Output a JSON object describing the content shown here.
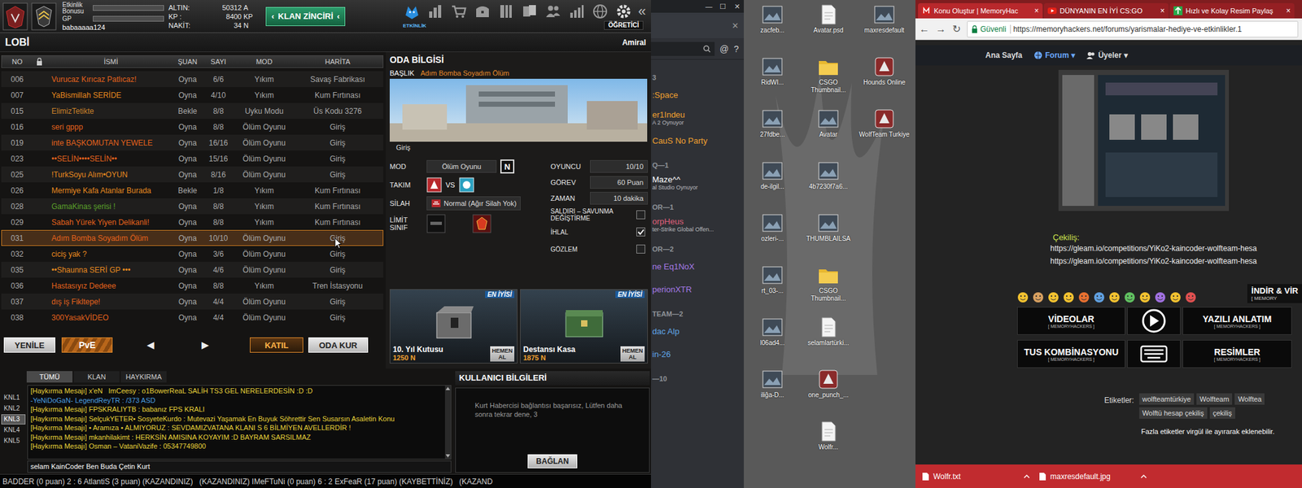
{
  "game": {
    "header": {
      "bonus_label": "Etkinlik Bonusu",
      "bonus_level": 0,
      "gp_label": "GP",
      "gp_level": 0,
      "username": "babaaaaa124",
      "currencies": [
        {
          "label": "ALTIN:",
          "value": "50312",
          "unit": "A"
        },
        {
          "label": "KP :",
          "value": "8400",
          "unit": "KP"
        },
        {
          "label": "NAKİT:",
          "value": "34",
          "unit": "N"
        }
      ],
      "clan_chain": {
        "left": "‹",
        "label": "KLAN ZİNCİRİ",
        "right": "‹"
      },
      "event_label": "ETKİNLİK",
      "collapse": "«",
      "tutorial": "ÖĞRETİCİ"
    },
    "lobby": {
      "title": "LOBİ",
      "rank": "Amiral",
      "columns": [
        "NO",
        "İSMİ",
        "ŞUAN",
        "SAYI",
        "MOD",
        "HARİTA"
      ],
      "rows": [
        {
          "cells": [
            "006",
            "Vurucaz Kırıcaz Patlıcaz!",
            "Oyna",
            "6/6",
            "Yıkım",
            "Savaş Fabrikası"
          ],
          "color": "#e3621c",
          "selected": false
        },
        {
          "cells": [
            "007",
            "YaBismillah SERİDE",
            "Oyna",
            "4/10",
            "Yıkım",
            "Kum Fırtınası"
          ],
          "color": "#e6891f",
          "selected": false
        },
        {
          "cells": [
            "015",
            "ElimizTetikte",
            "Bekle",
            "8/8",
            "Uyku Modu",
            "Üs Kodu 3276"
          ],
          "color": "#c9812a",
          "selected": false
        },
        {
          "cells": [
            "016",
            "seri gppp",
            "Oyna",
            "8/8",
            "Ölüm Oyunu",
            "Giriş"
          ],
          "color": "#e3621c",
          "selected": false
        },
        {
          "cells": [
            "019",
            "inte BAŞKOMUTAN YEWELE",
            "Oyna",
            "16/16",
            "Ölüm Oyunu",
            "Giriş"
          ],
          "color": "#e3621c",
          "selected": false
        },
        {
          "cells": [
            "023",
            "••SELİN••••SELİN••",
            "Oyna",
            "15/16",
            "Ölüm Oyunu",
            "Giriş"
          ],
          "color": "#e3621c",
          "selected": false
        },
        {
          "cells": [
            "025",
            "!TurkSoyu Alım•OYUN",
            "Oyna",
            "8/16",
            "Ölüm Oyunu",
            "Giriş"
          ],
          "color": "#e6891f",
          "selected": false
        },
        {
          "cells": [
            "026",
            "Mermiye Kafa Atanlar Burada",
            "Bekle",
            "1/8",
            "Yıkım",
            "Kum Fırtınası"
          ],
          "color": "#e6891f",
          "selected": false
        },
        {
          "cells": [
            "028",
            "GamaKinas şerisi !",
            "Oyna",
            "8/8",
            "Yıkım",
            "Kum Fırtınası"
          ],
          "color": "#5aa02a",
          "selected": false
        },
        {
          "cells": [
            "029",
            "Sabah Yürek Yiyen Delikanli!",
            "Oyna",
            "8/8",
            "Yıkım",
            "Kum Fırtınası"
          ],
          "color": "#e3621c",
          "selected": false
        },
        {
          "cells": [
            "031",
            "Adım Bomba Soyadım Ölüm",
            "Oyna",
            "10/10",
            "Ölüm Oyunu",
            "Giriş"
          ],
          "color": "#e3621c",
          "selected": true
        },
        {
          "cells": [
            "032",
            "ciciş yak ?",
            "Oyna",
            "3/6",
            "Ölüm Oyunu",
            "Giriş"
          ],
          "color": "#e6891f",
          "selected": false
        },
        {
          "cells": [
            "035",
            "••Shaunna SERİ GP •••",
            "Oyna",
            "4/6",
            "Ölüm Oyunu",
            "Giriş"
          ],
          "color": "#e6891f",
          "selected": false
        },
        {
          "cells": [
            "036",
            "Hastasıyız Dedeee",
            "Oyna",
            "8/8",
            "Yıkım",
            "Tren İstasyonu"
          ],
          "color": "#e3621c",
          "selected": false
        },
        {
          "cells": [
            "037",
            "dış iş Fikltepe!",
            "Oyna",
            "4/4",
            "Ölüm Oyunu",
            "Giriş"
          ],
          "color": "#e3621c",
          "selected": false
        },
        {
          "cells": [
            "038",
            "300YasakVİDEO",
            "Oyna",
            "4/4",
            "Ölüm Oyunu",
            "Giriş"
          ],
          "color": "#e3621c",
          "selected": false
        }
      ],
      "buttons": {
        "refresh": "YENİLE",
        "mode": "PvE",
        "prev": "◀",
        "next": "▶",
        "join": "KATIL",
        "create": "ODA KUR"
      }
    },
    "room": {
      "title": "ODA BİLGİSİ",
      "heading_label": "BAŞLIK",
      "heading": "Adım Bomba Soyadım Ölüm",
      "map_caption": "Giriş",
      "mode_label": "MOD",
      "mode": "Ölüm Oyunu",
      "mode_badge": "N",
      "team_label": "TAKIM",
      "versus": "VS",
      "weapon_label": "SİLAH",
      "weapon": "Normal (Ağır Silah Yok)",
      "limit_label": "LİMİT SINIF",
      "stats": [
        {
          "label": "OYUNCU",
          "value": "10/10"
        },
        {
          "label": "GÖREV",
          "value": "60 Puan"
        },
        {
          "label": "ZAMAN",
          "value": "10 dakika"
        }
      ],
      "options": [
        {
          "label": "SALDIRI – SAVUNMA DEĞİŞTİRME",
          "checked": false
        },
        {
          "label": "İHLAL",
          "checked": true
        },
        {
          "label": "GÖZLEM",
          "checked": false
        }
      ]
    },
    "store": [
      {
        "name": "10. Yıl Kutusu",
        "price": "1250 N",
        "badge": "EN İYİSİ",
        "buy": "HEMEN AL"
      },
      {
        "name": "Destansı Kasa",
        "price": "1875 N",
        "badge": "EN İYİSİ",
        "buy": "HEMEN AL"
      }
    ],
    "chat": {
      "tabs": [
        {
          "label": "TÜMÜ",
          "selected": true
        },
        {
          "label": "KLAN",
          "selected": false
        },
        {
          "label": "HAYKIRMA",
          "selected": false
        }
      ],
      "channels": [
        {
          "label": "KNL1",
          "selected": false
        },
        {
          "label": "KNL2",
          "selected": false
        },
        {
          "label": "KNL3",
          "selected": true
        },
        {
          "label": "KNL4",
          "selected": false
        },
        {
          "label": "KNL5",
          "selected": false
        }
      ],
      "lines": [
        {
          "text": "[Haykırma Mesajı] x'eN   ImCeesy : o1BowerReaL SALİH TS3 GEL NERELERDESİN :D :D",
          "color": "#e8d33a"
        },
        {
          "text": "-YeNiDoGaN- LegendReyTR : /373 ASD",
          "color": "#4a9fe0"
        },
        {
          "text": "[Haykırma Mesajı] FPSKRALIYTB : babanız FPS KRALI",
          "color": "#e8d33a"
        },
        {
          "text": "[Haykırma Mesajı] SelçukYETER• SosyeteKurdo : Mutevazi Yaşamak En Buyuk Söhrettir Sen Susarsın Asaletin Konu",
          "color": "#e8d33a"
        },
        {
          "text": "[Haykırma Mesajı] • Aramıza • ALMIYORUZ : SEVDAMIZVATANA KLANI S 6 BİLMİYEN AVELLERDİR !",
          "color": "#e8d33a"
        },
        {
          "text": "[Haykırma Mesajı] mkanhilakimt : HERKSİN AMISINA KOYAYIM :D BAYRAM SARSILMAZ",
          "color": "#e8d33a"
        },
        {
          "text": "[Haykırma Mesajı] Osman – VataniVazife : 05347749800",
          "color": "#e8d33a"
        }
      ],
      "input": "selam KainCoder Ben Buda Çetin Kurt"
    },
    "user_info": {
      "title": "KULLANICI BİLGİLERİ",
      "message": "Kurt Habercisi bağlantısı başarısız, Lütfen daha sonra tekrar dene, 3",
      "button": "BAĞLAN"
    },
    "ticker": "BADDER (0 puan) 2 : 6 AtlantiS (3 puan) (KAZANDINIZ)   (KAZANDINIZ) IMeFTuNi (0 puan) 6 : 2 ExFeaR (17 puan) (KAYBETTİNİZ)   (KAZAND"
  },
  "discord": {
    "controls": [
      "—",
      "☐",
      "✕"
    ],
    "close": "✕",
    "at": "@",
    "help": "?",
    "items": [
      {
        "kind": "header",
        "text": "3"
      },
      {
        "kind": "user",
        "text": ":Space",
        "color": "#f0a030"
      },
      {
        "kind": "user",
        "text": "er1Indeu",
        "color": "#f0a030",
        "activity": "A 2 Oynuyor"
      },
      {
        "kind": "user",
        "text": "CauS No Party",
        "color": "#f0a030"
      },
      {
        "kind": "header",
        "text": "Q—1"
      },
      {
        "kind": "user",
        "text": "Maze^^",
        "color": "#ffffff",
        "activity": "al Studio Oynuyor"
      },
      {
        "kind": "header",
        "text": "OR—1"
      },
      {
        "kind": "user",
        "text": "orpHeus",
        "color": "#e0607a",
        "activity": "ter-Strike Global Offen..."
      },
      {
        "kind": "header",
        "text": "OR—2"
      },
      {
        "kind": "user",
        "text": "ne Eq1NoX",
        "color": "#a57ae6"
      },
      {
        "kind": "user",
        "text": "perionXTR",
        "color": "#a57ae6"
      },
      {
        "kind": "header",
        "text": "TEAM—2"
      },
      {
        "kind": "user",
        "text": "dac Alp",
        "color": "#5fa6ea"
      },
      {
        "kind": "user",
        "text": "in-26",
        "color": "#5fa6ea"
      },
      {
        "kind": "header",
        "text": "—10"
      }
    ]
  },
  "desktop": {
    "columns": [
      [
        {
          "label": "zacfeb...",
          "kind": "image"
        },
        {
          "label": "RidWI...",
          "kind": "image"
        },
        {
          "label": "27fdbe...",
          "kind": "image"
        },
        {
          "label": "de-ilgil...",
          "kind": "image"
        },
        {
          "label": "ozleri-...",
          "kind": "image"
        },
        {
          "label": "rt_03-...",
          "kind": "image"
        },
        {
          "label": "l06ad4...",
          "kind": "image"
        },
        {
          "label": "iliğa-D...",
          "kind": "image"
        }
      ],
      [
        {
          "label": "Avatar.psd",
          "kind": "file"
        },
        {
          "label": "CSGO Thumbnail...",
          "kind": "folder"
        },
        {
          "label": "Avatar",
          "kind": "image"
        },
        {
          "label": "4b7230f7a6...",
          "kind": "image"
        },
        {
          "label": "THUMBLAILSA",
          "kind": "image"
        },
        {
          "label": "CSGO Thumbnail...",
          "kind": "folder"
        },
        {
          "label": "selamlartürki...",
          "kind": "file"
        },
        {
          "label": "one_punch_...",
          "kind": "app"
        },
        {
          "label": "Wolfr...",
          "kind": "file"
        }
      ],
      [
        {
          "label": "maxresdefault",
          "kind": "image"
        },
        {
          "label": "Hounds Online",
          "kind": "app"
        },
        {
          "label": "WolfTeam Turkiye",
          "kind": "app"
        }
      ]
    ]
  },
  "browser": {
    "tabs": [
      {
        "label": "Konu Oluştur | MemoryHac",
        "close": "×",
        "selected": true
      },
      {
        "label": "DÜNYANIN EN İYİ CS:GO",
        "close": "×",
        "selected": false
      },
      {
        "label": "Hızlı ve Kolay Resim Paylaş",
        "close": "×",
        "selected": false
      }
    ],
    "back": "←",
    "forward": "→",
    "reload": "↻",
    "secure": "Güvenli",
    "url": "https://memoryhackers.net/forums/yarismalar-hediye-ve-etkinlikler.1",
    "site_nav": [
      {
        "label": "Ana Sayfa",
        "selected": false
      },
      {
        "label": "Forum",
        "caret": "▾",
        "selected": true
      },
      {
        "label": "Üyeler",
        "caret": "▾",
        "selected": false
      }
    ],
    "giveaway_label": "Çekiliş:",
    "links": [
      "https://gleam.io/competitions/YiKo2-kaincoder-wolfteam-hesa",
      "https://gleam.io/competitions/YiKo2-kaincoder-wolfteam-hesa"
    ],
    "download_banner": {
      "title": "İNDİR & VİR",
      "subtitle": "[ MEMORY"
    },
    "banners": [
      {
        "title": "VİDEOLAR",
        "subtitle": "[ MEMORYHACKERS ]"
      },
      {
        "title": "YAZILI ANLATIM",
        "subtitle": "[ MEMORYHACKERS ]"
      },
      {
        "title": "TUS KOMBİNASYONU",
        "subtitle": "[ MEMORYHACKERS ]"
      },
      {
        "title": "RESİMLER",
        "subtitle": "[ MEMORYHACKERS ]"
      }
    ],
    "tags_label": "Etiketler:",
    "tags": [
      "wolfteamtürkiye",
      "Wolfteam",
      "Wolftea",
      "Wolftü hesap çekiliş",
      "çekiliş"
    ],
    "tags_hint": "Fazla etiketler virgül ile ayırarak eklenebilir.",
    "downloads": [
      {
        "name": "Wolfr.txt"
      },
      {
        "name": "maxresdefault.jpg"
      }
    ]
  }
}
